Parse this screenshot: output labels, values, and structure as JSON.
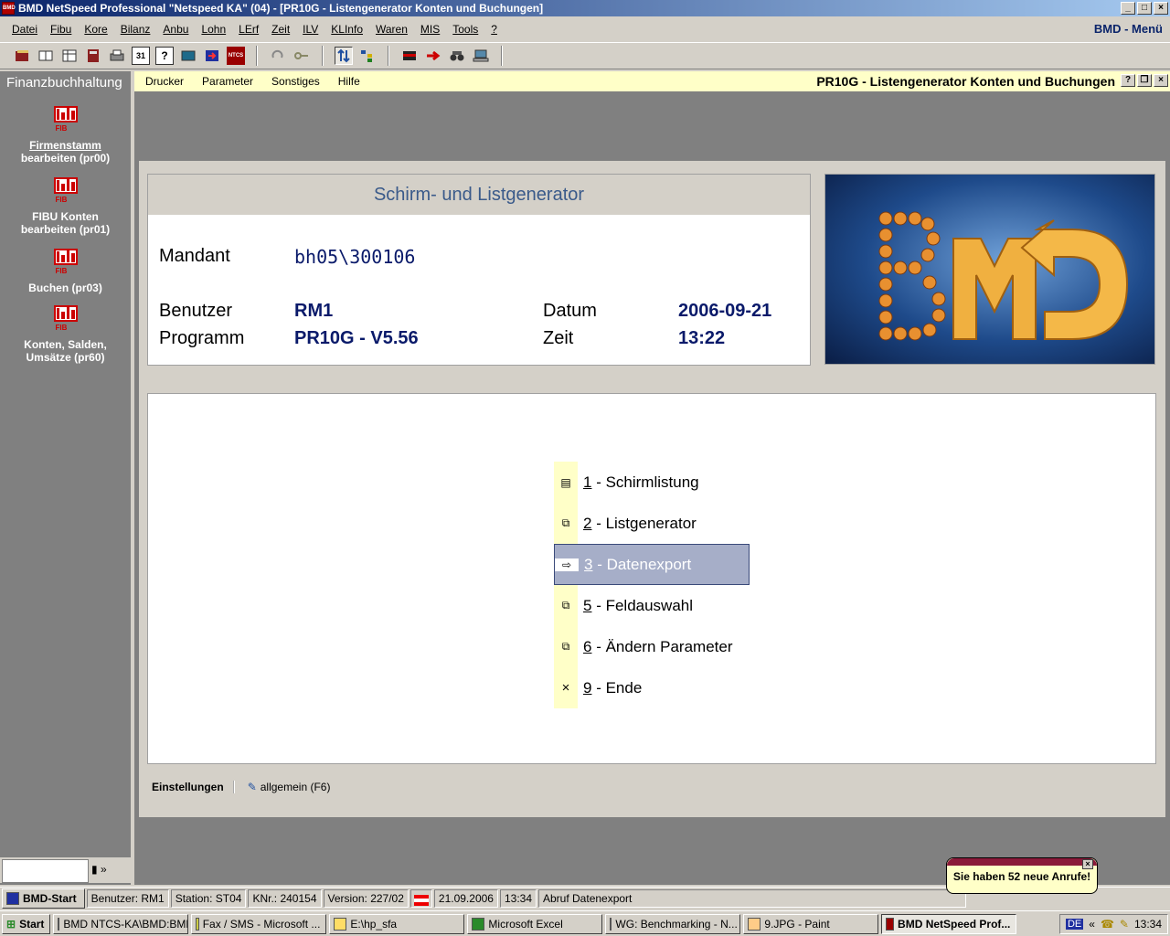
{
  "window": {
    "title": "BMD NetSpeed Professional \"Netspeed KA\" (04) - [PR10G - Listengenerator Konten und Buchungen]",
    "app_icon": "BMD"
  },
  "menubar": {
    "items": [
      "Datei",
      "Fibu",
      "Kore",
      "Bilanz",
      "Anbu",
      "Lohn",
      "LErf",
      "Zeit",
      "ILV",
      "KLInfo",
      "Waren",
      "MIS",
      "Tools",
      "?"
    ],
    "right_label": "BMD - Menü"
  },
  "toolbar": {
    "icons": [
      "book-icon",
      "contacts-icon",
      "table-icon",
      "calculator-icon",
      "print-icon",
      "calendar-icon",
      "help-icon",
      "screen-icon",
      "exit-icon",
      "ntcs-icon",
      "undo-icon",
      "key-icon",
      "switch-icon",
      "tree-icon",
      "flag-icon",
      "arrow-right-icon",
      "binoculars-icon",
      "computer-icon"
    ],
    "calendar_text": "31",
    "help_text": "?",
    "ntcs_text": "NTCS"
  },
  "sidebar": {
    "header": "Finanzbuchhaltung",
    "icon_label": "FIB",
    "items": [
      {
        "line1": "Firmenstamm",
        "line2": "bearbeiten (pr00)"
      },
      {
        "line1": "FIBU Konten",
        "line2": "bearbeiten (pr01)"
      },
      {
        "line1": "Buchen (pr03)",
        "line2": ""
      },
      {
        "line1": "Konten, Salden,",
        "line2": "Umsätze (pr60)"
      }
    ]
  },
  "subwindow": {
    "menu": [
      "Drucker",
      "Parameter",
      "Sonstiges",
      "Hilfe"
    ],
    "title": "PR10G - Listengenerator Konten und Buchungen"
  },
  "info": {
    "heading": "Schirm- und Listgenerator",
    "mandant_label": "Mandant",
    "mandant_value": "bh05\\300106",
    "benutzer_label": "Benutzer",
    "benutzer_value": "RM1",
    "programm_label": "Programm",
    "programm_value": "PR10G - V5.56",
    "datum_label": "Datum",
    "datum_value": "2006-09-21",
    "zeit_label": "Zeit",
    "zeit_value": "13:22"
  },
  "options": [
    {
      "key": "1",
      "label": " - Schirmlistung",
      "icon": "list-icon",
      "selected": false
    },
    {
      "key": "2",
      "label": " - Listgenerator",
      "icon": "generator-icon",
      "selected": false
    },
    {
      "key": "3",
      "label": " - Datenexport",
      "icon": "export-icon",
      "selected": true
    },
    {
      "key": "5",
      "label": " - Feldauswahl",
      "icon": "field-select-icon",
      "selected": false
    },
    {
      "key": "6",
      "label": " - Ändern Parameter",
      "icon": "parameter-icon",
      "selected": false
    },
    {
      "key": "9",
      "label": " - Ende",
      "icon": "close-icon",
      "selected": false
    }
  ],
  "bottom": {
    "settings_label": "Einstellungen",
    "general_label": "allgemein (F6)"
  },
  "statusbar": {
    "start_label": "BMD-Start",
    "cells": [
      "Benutzer: RM1",
      "Station: ST04",
      "KNr.: 240154",
      "Version: 227/02",
      "",
      "21.09.2006",
      "13:34",
      "Abruf Datenexport"
    ]
  },
  "taskbar": {
    "start": "Start",
    "buttons": [
      {
        "label": "BMD NTCS-KA\\BMD:BMD",
        "active": false
      },
      {
        "label": "Fax / SMS - Microsoft ...",
        "active": false
      },
      {
        "label": "E:\\hp_sfa",
        "active": false
      },
      {
        "label": "Microsoft Excel",
        "active": false
      },
      {
        "label": "WG: Benchmarking - N...",
        "active": false
      },
      {
        "label": "9.JPG - Paint",
        "active": false
      },
      {
        "label": "BMD NetSpeed Prof...",
        "active": true
      }
    ],
    "lang": "DE",
    "tray_chevron": "«",
    "clock": "13:34"
  },
  "balloon": {
    "text": "Sie haben 52 neue Anrufe!"
  },
  "colors": {
    "title_start": "#0a246a",
    "title_end": "#a6caf0",
    "accent_yellow": "#ffffc8",
    "selected_bg": "#a6aec8",
    "value_blue": "#0a1a6a"
  }
}
